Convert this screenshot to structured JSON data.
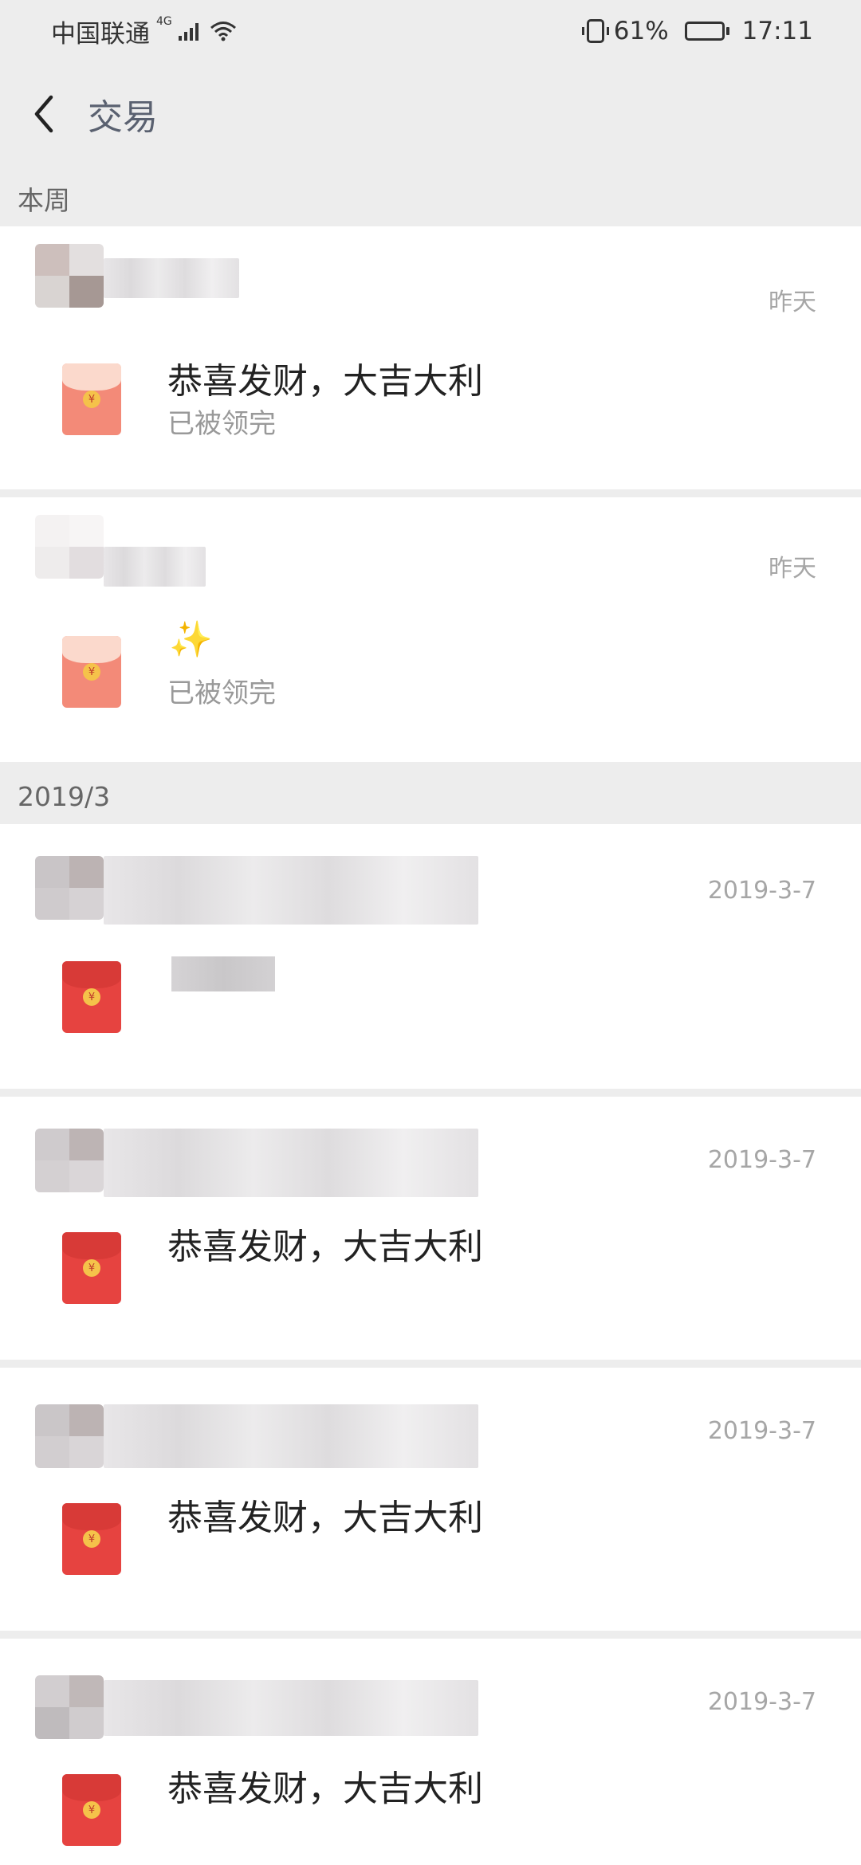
{
  "status_bar": {
    "carrier": "中国联通",
    "network": "4G",
    "battery_percent": "61%",
    "battery_level": 0.61,
    "time": "17:11"
  },
  "nav": {
    "title": "交易",
    "back_icon": "chevron-left-icon"
  },
  "sections": [
    {
      "title": "本周"
    },
    {
      "title": "2019/3"
    }
  ],
  "transactions": [
    {
      "date": "昨天",
      "message": "恭喜发财，大吉大利",
      "status": "已被领完",
      "envelope": "opened",
      "icon": "red-envelope-icon"
    },
    {
      "date": "昨天",
      "message": "✨",
      "status": "已被领完",
      "envelope": "opened",
      "icon": "red-envelope-icon"
    },
    {
      "date": "2019-3-7",
      "message": "",
      "status": "",
      "envelope": "unopened",
      "icon": "red-envelope-icon"
    },
    {
      "date": "2019-3-7",
      "message": "恭喜发财，大吉大利",
      "status": "",
      "envelope": "unopened",
      "icon": "red-envelope-icon"
    },
    {
      "date": "2019-3-7",
      "message": "恭喜发财，大吉大利",
      "status": "",
      "envelope": "unopened",
      "icon": "red-envelope-icon"
    },
    {
      "date": "2019-3-7",
      "message": "恭喜发财，大吉大利",
      "status": "",
      "envelope": "unopened",
      "icon": "red-envelope-icon"
    }
  ],
  "colors": {
    "background": "#ededed",
    "card": "#ffffff",
    "envelope_red": "#e64340",
    "envelope_opened": "#f38a78",
    "date_gray": "#a6a6a6"
  }
}
